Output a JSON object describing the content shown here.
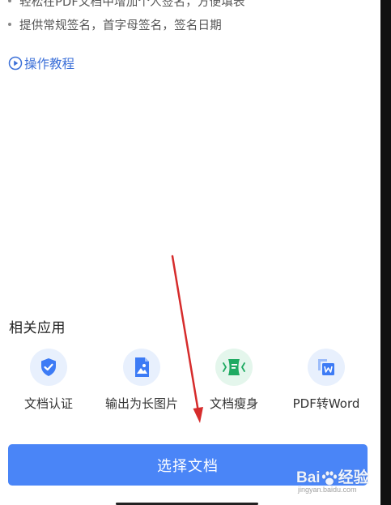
{
  "description": {
    "bullets": [
      "轻松在PDF文档中增加个人签名，方便填表",
      "提供常规签名，首字母签名，签名日期"
    ],
    "tutorial_link": "操作教程"
  },
  "related_apps": {
    "title": "相关应用",
    "items": [
      {
        "label": "文档认证",
        "icon": "shield-check-icon",
        "bg": "#e8f0fd",
        "color": "#3d7bf5"
      },
      {
        "label": "输出为长图片",
        "icon": "image-file-icon",
        "bg": "#e8f0fd",
        "color": "#3d7bf5"
      },
      {
        "label": "文档瘦身",
        "icon": "compress-doc-icon",
        "bg": "#e4f6ec",
        "color": "#1faa62"
      },
      {
        "label": "PDF转Word",
        "icon": "pdf-to-word-icon",
        "bg": "#e8f0fd",
        "color": "#3d7bf5"
      }
    ]
  },
  "primary_action": {
    "label": "选择文档",
    "color": "#4a85f7"
  },
  "watermark": {
    "brand": "Bai",
    "brand_suffix": "经验",
    "url": "jingyan.baidu.com"
  },
  "annotation": {
    "arrow_color": "#d62c2c"
  }
}
